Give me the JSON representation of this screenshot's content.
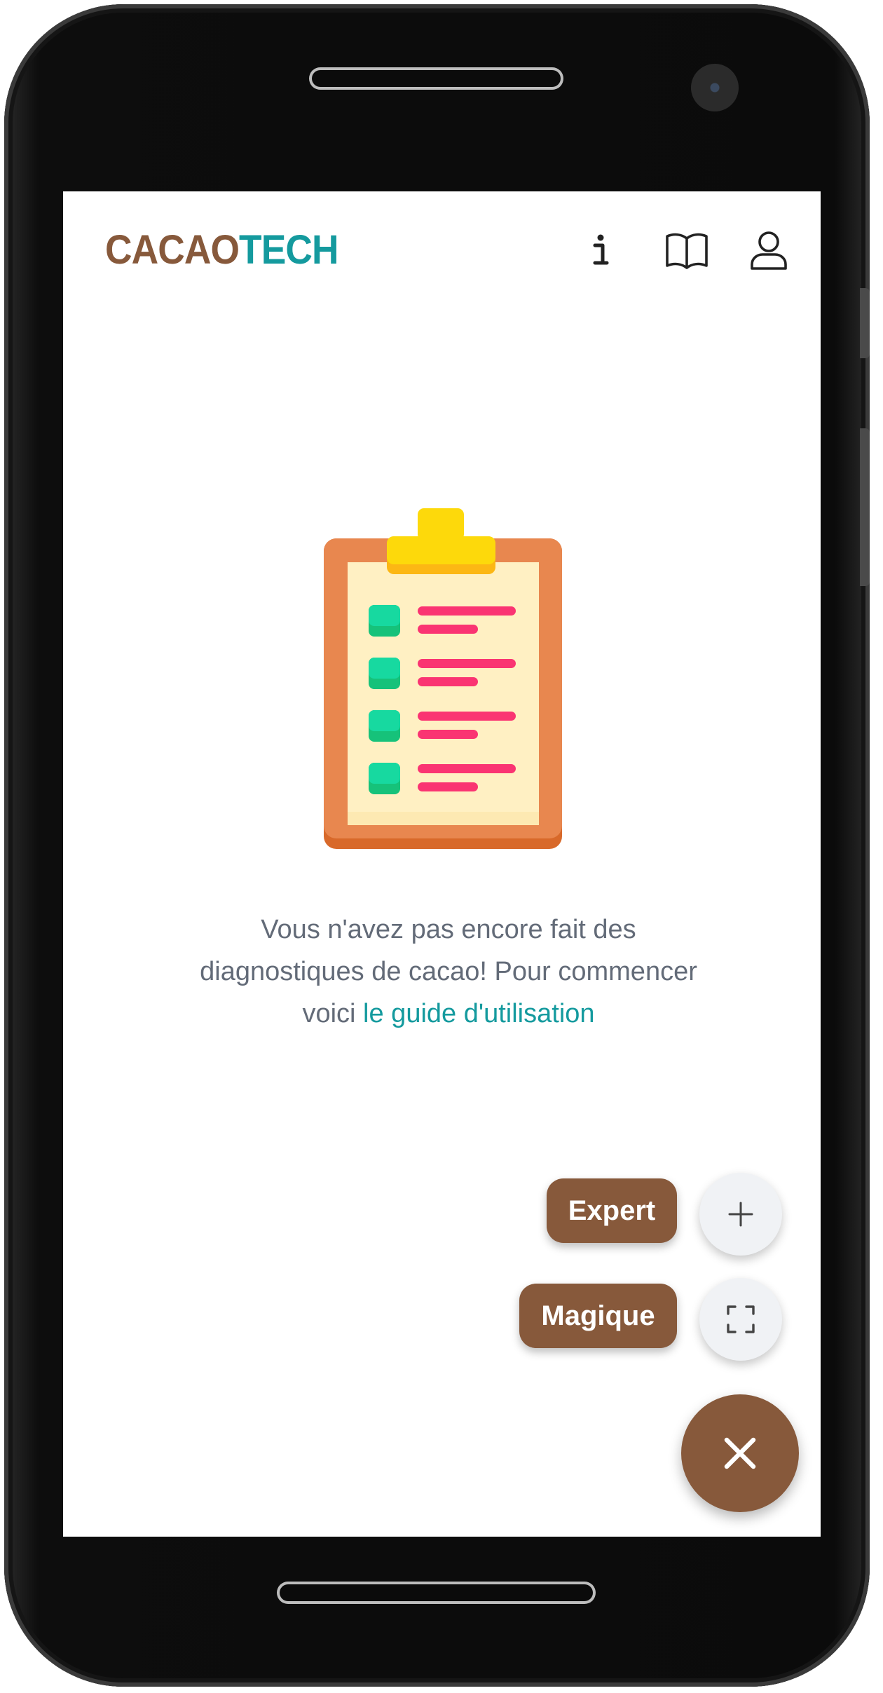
{
  "app": {
    "logo_part1": "CACAO",
    "logo_part2": "TECH"
  },
  "header": {
    "icons": [
      "info-icon",
      "book-icon",
      "user-icon"
    ]
  },
  "empty_state": {
    "illustration": "clipboard-checklist-icon",
    "message": "Vous n'avez pas encore fait des diagnostiques de cacao! Pour commencer voici ",
    "link_text": "le guide d'utilisation"
  },
  "fab_menu": {
    "expert_label": "Expert",
    "magique_label": "Magique",
    "expert_icon": "plus-icon",
    "magique_icon": "scan-icon",
    "main_icon": "close-icon"
  },
  "colors": {
    "brand_brown": "#87593b",
    "brand_teal": "#149a9e",
    "text_gray": "#636b78",
    "fab_mini_bg": "#f0f2f5"
  }
}
